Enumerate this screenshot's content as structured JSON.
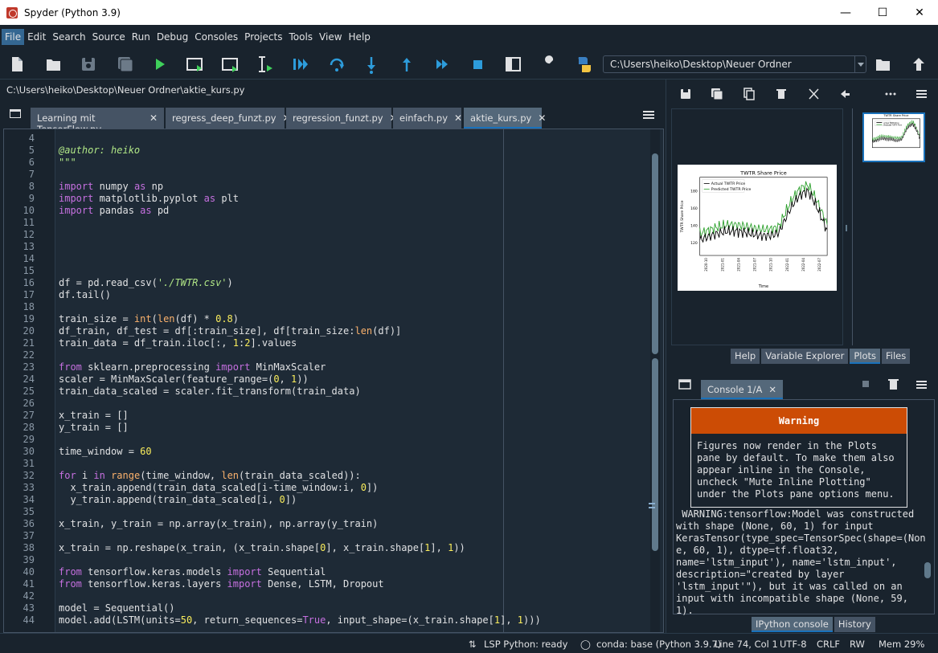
{
  "window": {
    "title": "Spyder (Python 3.9)"
  },
  "menu": [
    "File",
    "Edit",
    "Search",
    "Source",
    "Run",
    "Debug",
    "Consoles",
    "Projects",
    "Tools",
    "View",
    "Help"
  ],
  "toolbar": {
    "path": "C:\\Users\\heiko\\Desktop\\Neuer Ordner"
  },
  "editor": {
    "path": "C:\\Users\\heiko\\Desktop\\Neuer Ordner\\aktie_kurs.py",
    "tabs": [
      "Learning mit TensorFlow.py",
      "regress_deep_funzt.py",
      "regression_funzt.py",
      "einfach.py",
      "aktie_kurs.py"
    ],
    "active_tab": 4,
    "lines": [
      {
        "n": "4",
        "t": ""
      },
      {
        "n": "5",
        "t": "@author: heiko"
      },
      {
        "n": "6",
        "t": "\"\"\""
      },
      {
        "n": "7",
        "t": ""
      },
      {
        "n": "8",
        "t": "import numpy as np"
      },
      {
        "n": "9",
        "t": "import matplotlib.pyplot as plt"
      },
      {
        "n": "10",
        "t": "import pandas as pd"
      },
      {
        "n": "11",
        "t": ""
      },
      {
        "n": "12",
        "t": ""
      },
      {
        "n": "13",
        "t": ""
      },
      {
        "n": "14",
        "t": ""
      },
      {
        "n": "15",
        "t": ""
      },
      {
        "n": "16",
        "t": "df = pd.read_csv('./TWTR.csv')"
      },
      {
        "n": "17",
        "t": "df.tail()"
      },
      {
        "n": "18",
        "t": ""
      },
      {
        "n": "19",
        "t": "train_size = int(len(df) * 0.8)"
      },
      {
        "n": "20",
        "t": "df_train, df_test = df[:train_size], df[train_size:len(df)]"
      },
      {
        "n": "21",
        "t": "train_data = df_train.iloc[:, 1:2].values"
      },
      {
        "n": "22",
        "t": ""
      },
      {
        "n": "23",
        "t": "from sklearn.preprocessing import MinMaxScaler"
      },
      {
        "n": "24",
        "t": "scaler = MinMaxScaler(feature_range=(0, 1))"
      },
      {
        "n": "25",
        "t": "train_data_scaled = scaler.fit_transform(train_data)"
      },
      {
        "n": "26",
        "t": ""
      },
      {
        "n": "27",
        "t": "x_train = []"
      },
      {
        "n": "28",
        "t": "y_train = []"
      },
      {
        "n": "29",
        "t": ""
      },
      {
        "n": "30",
        "t": "time_window = 60"
      },
      {
        "n": "31",
        "t": ""
      },
      {
        "n": "32",
        "t": "for i in range(time_window, len(train_data_scaled)):"
      },
      {
        "n": "33",
        "t": "  x_train.append(train_data_scaled[i-time_window:i, 0])"
      },
      {
        "n": "34",
        "t": "  y_train.append(train_data_scaled[i, 0])"
      },
      {
        "n": "35",
        "t": ""
      },
      {
        "n": "36",
        "t": "x_train, y_train = np.array(x_train), np.array(y_train)"
      },
      {
        "n": "37",
        "t": ""
      },
      {
        "n": "38",
        "t": "x_train = np.reshape(x_train, (x_train.shape[0], x_train.shape[1], 1))"
      },
      {
        "n": "39",
        "t": ""
      },
      {
        "n": "40",
        "t": "from tensorflow.keras.models import Sequential"
      },
      {
        "n": "41",
        "t": "from tensorflow.keras.layers import Dense, LSTM, Dropout"
      },
      {
        "n": "42",
        "t": ""
      },
      {
        "n": "43",
        "t": "model = Sequential()"
      },
      {
        "n": "44",
        "t": "model.add(LSTM(units=50, return_sequences=True, input_shape=(x_train.shape[1], 1)))"
      }
    ]
  },
  "plots": {
    "tabs": [
      "Help",
      "Variable Explorer",
      "Plots",
      "Files"
    ],
    "active_tab": 2,
    "figure": {
      "title": "TWTR Share Price",
      "ylabel": "TWTR Share Price",
      "xlabel": "Time",
      "legend": [
        "Actual TWTR Price",
        "Predicted TWTR Price"
      ],
      "yticks": [
        "180",
        "160",
        "140",
        "120"
      ],
      "xticks": [
        "2020-10",
        "2021-01",
        "2021-04",
        "2021-07",
        "2021-10",
        "2022-01",
        "2022-04",
        "2022-07"
      ],
      "series_colors": [
        "#000000",
        "#2ca02c"
      ]
    }
  },
  "console": {
    "tab_label": "Console 1/A",
    "warning_title": "Warning",
    "warning_body": "Figures now render in the Plots pane by default. To make them also appear inline in the Console, uncheck \"Mute Inline Plotting\" under the Plots pane options menu.",
    "output": " WARNING:tensorflow:Model was constructed\nwith shape (None, 60, 1) for input\nKerasTensor(type_spec=TensorSpec(shape=(Non\ne, 60, 1), dtype=tf.float32,\nname='lstm_input'), name='lstm_input',\ndescription=\"created by layer\n'lstm_input'\"), but it was called on an\ninput with incompatible shape (None, 59,\n1).",
    "tabs": [
      "IPython console",
      "History"
    ],
    "active_tab": 0
  },
  "status": {
    "lsp": "LSP Python: ready",
    "conda": "conda: base (Python 3.9.7)",
    "position": "Line 74, Col 1",
    "encoding": "UTF-8",
    "eol": "CRLF",
    "rw": "RW",
    "mem": "Mem 29%"
  }
}
